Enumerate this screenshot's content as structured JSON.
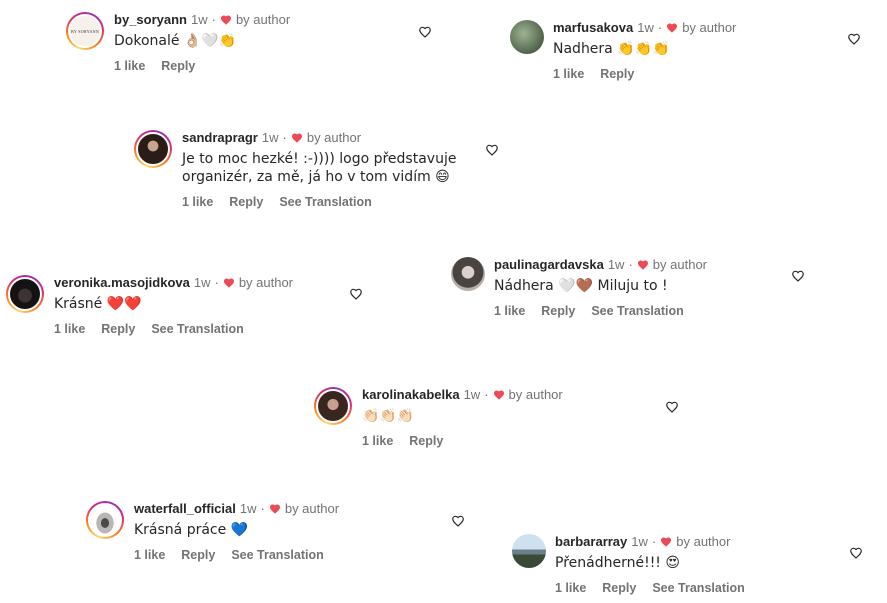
{
  "author_badge_label": "by author",
  "time_label": "1w",
  "separator": "·",
  "comments": [
    {
      "username": "by_soryann",
      "avatar_text": "BY SORYANN",
      "text": "Dokonalé 👌🏼🤍👏",
      "likes": "1 like",
      "reply": "Reply"
    },
    {
      "username": "marfusakova",
      "text": "Nadhera 👏👏👏",
      "likes": "1 like",
      "reply": "Reply"
    },
    {
      "username": "sandrapragr",
      "text_line1": "Je to moc hezké! :-)))) logo představuje",
      "text_line2": "organizér, za mě, já ho v tom vidím 😄",
      "likes": "1 like",
      "reply": "Reply",
      "translate": "See Translation"
    },
    {
      "username": "veronika.masojidkova",
      "text": "Krásné ❤️❤️",
      "likes": "1 like",
      "reply": "Reply",
      "translate": "See Translation"
    },
    {
      "username": "paulinagardavska",
      "text": "Nádhera 🤍🤎 Miluju to !",
      "likes": "1 like",
      "reply": "Reply",
      "translate": "See Translation"
    },
    {
      "username": "karolinakabelka",
      "text": "👏🏻👏🏻👏🏻",
      "likes": "1 like",
      "reply": "Reply"
    },
    {
      "username": "waterfall_official",
      "text": "Krásná práce 💙",
      "likes": "1 like",
      "reply": "Reply",
      "translate": "See Translation"
    },
    {
      "username": "barbararray",
      "text": "Přenádherné!!! 😍",
      "likes": "1 like",
      "reply": "Reply",
      "translate": "See Translation"
    }
  ],
  "colors": {
    "text": "#262626",
    "secondary": "#737373",
    "heart": "#ed4956"
  },
  "icons": {
    "author_heart": "heart-filled-icon",
    "like": "heart-outline-icon"
  }
}
